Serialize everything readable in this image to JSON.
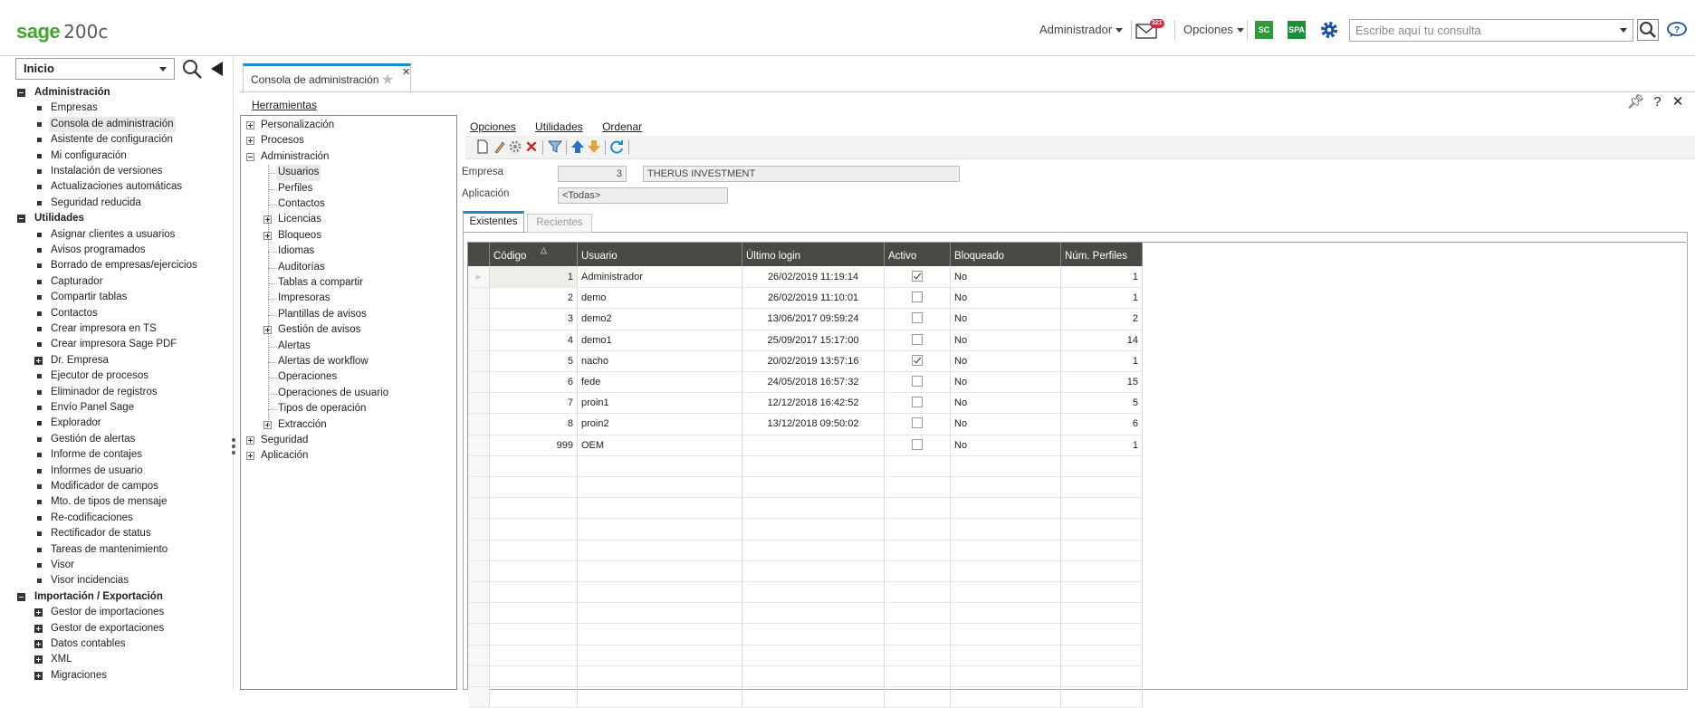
{
  "topbar": {
    "logo_brand": "sage",
    "logo_version": "200c",
    "user_menu": "Administrador",
    "mail_count": "321",
    "options_menu": "Opciones",
    "btn_sc": "SC",
    "btn_spa": "SPA",
    "search_placeholder": "Escribe aquí tu consulta",
    "colors": {
      "brand_green": "#41a62a",
      "accent_blue": "#1a8ccc",
      "sc_green": "#2e9a3a",
      "spa_green": "#1b8f3a",
      "gear_blue": "#1b4fa0"
    }
  },
  "sidebar": {
    "selector": "Inicio",
    "groups": [
      {
        "label": "Administración",
        "items": [
          "Empresas",
          "Consola de administración",
          "Asistente de configuración",
          "Mi configuración",
          "Instalación de versiones",
          "Actualizaciones automáticas",
          "Seguridad reducida"
        ]
      },
      {
        "label": "Utilidades",
        "items": [
          "Asignar clientes a usuarios",
          "Avisos programados",
          "Borrado de empresas/ejercicios",
          "Capturador",
          "Compartir tablas",
          "Contactos",
          "Crear impresora en TS",
          "Crear impresora Sage PDF",
          "Dr. Empresa",
          "Ejecutor de procesos",
          "Eliminador de registros",
          "Envío Panel Sage",
          "Explorador",
          "Gestión de alertas",
          "Informe de contajes",
          "Informes de usuario",
          "Modificador de campos",
          "Mto. de tipos de mensaje",
          "Re-codificaciones",
          "Rectificador de status",
          "Tareas de mantenimiento",
          "Visor",
          "Visor incidencias"
        ]
      },
      {
        "label": "Importación / Exportación",
        "items": [
          "Gestor de importaciones",
          "Gestor de exportaciones",
          "Datos contables",
          "XML",
          "Migraciones"
        ]
      }
    ]
  },
  "document_tab": {
    "label": "Consola de administración"
  },
  "tools_menu": "Herramientas",
  "tree": {
    "roots": [
      "Personalización",
      "Procesos",
      "Administración",
      "Seguridad",
      "Aplicación"
    ],
    "admin_children": [
      "Usuarios",
      "Perfiles",
      "Contactos",
      "Licencias",
      "Bloqueos",
      "Idiomas",
      "Auditorías",
      "Tablas a compartir",
      "Impresoras",
      "Plantillas de avisos",
      "Gestión de avisos",
      "Alertas",
      "Alertas de workflow",
      "Operaciones",
      "Operaciones de usuario",
      "Tipos de operación",
      "Extracción"
    ]
  },
  "menu2": {
    "opciones": "Opciones",
    "utilidades": "Utilidades",
    "ordenar": "Ordenar"
  },
  "form": {
    "empresa_label": "Empresa",
    "empresa_code": "3",
    "empresa_name": "THERUS INVESTMENT",
    "aplicacion_label": "Aplicación",
    "aplicacion_value": "<Todas>"
  },
  "tabs": {
    "existentes": "Existentes",
    "recientes": "Recientes"
  },
  "grid": {
    "headers": [
      "Código",
      "Usuario",
      "Último login",
      "Activo",
      "Bloqueado",
      "Núm. Perfiles"
    ],
    "rows": [
      {
        "codigo": "1",
        "usuario": "Administrador",
        "login": "26/02/2019 11:19:14",
        "activo": true,
        "bloqueado": "No",
        "perfiles": "1"
      },
      {
        "codigo": "2",
        "usuario": "demo",
        "login": "26/02/2019 11:10:01",
        "activo": false,
        "bloqueado": "No",
        "perfiles": "1"
      },
      {
        "codigo": "3",
        "usuario": "demo2",
        "login": "13/06/2017 09:59:24",
        "activo": false,
        "bloqueado": "No",
        "perfiles": "2"
      },
      {
        "codigo": "4",
        "usuario": "demo1",
        "login": "25/09/2017 15:17:00",
        "activo": false,
        "bloqueado": "No",
        "perfiles": "14"
      },
      {
        "codigo": "5",
        "usuario": "nacho",
        "login": "20/02/2019 13:57:16",
        "activo": true,
        "bloqueado": "No",
        "perfiles": "1"
      },
      {
        "codigo": "6",
        "usuario": "fede",
        "login": "24/05/2018 16:57:32",
        "activo": false,
        "bloqueado": "No",
        "perfiles": "15"
      },
      {
        "codigo": "7",
        "usuario": "proin1",
        "login": "12/12/2018 16:42:52",
        "activo": false,
        "bloqueado": "No",
        "perfiles": "5"
      },
      {
        "codigo": "8",
        "usuario": "proin2",
        "login": "13/12/2018 09:50:02",
        "activo": false,
        "bloqueado": "No",
        "perfiles": "6"
      },
      {
        "codigo": "999",
        "usuario": "OEM",
        "login": "",
        "activo": false,
        "bloqueado": "No",
        "perfiles": "1"
      }
    ]
  }
}
